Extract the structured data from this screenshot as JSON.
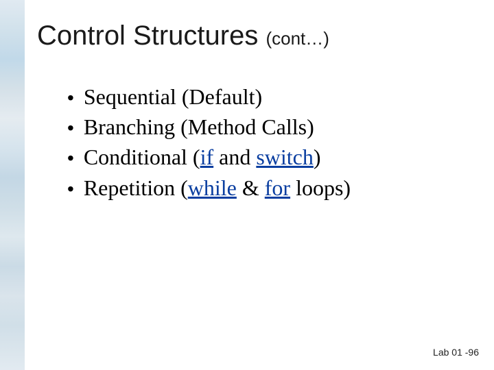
{
  "title": {
    "main": "Control Structures",
    "sub": "(cont…)"
  },
  "bullets": [
    {
      "pre": "Sequential (Default)",
      "kw": []
    },
    {
      "pre": "Branching (Method Calls)",
      "kw": []
    },
    {
      "pre": "Conditional (",
      "kw": [
        "if",
        " and ",
        "switch"
      ],
      "post": ")"
    },
    {
      "pre": "Repetition (",
      "kw": [
        "while",
        " & ",
        "for"
      ],
      "post": " loops)"
    }
  ],
  "footer": "Lab 01 -96"
}
